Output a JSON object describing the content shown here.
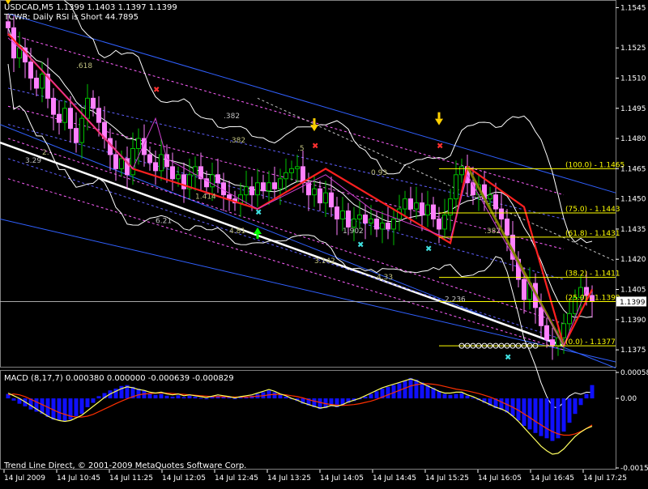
{
  "window": {
    "symbol_line": "USDCAD,M5  1.1399 1.1403 1.1397 1.1399",
    "indicator_line": "TCWR: Daily RSI is Short 44.7895",
    "footer": "Trend Line Direct, © 2001-2009 MetaQuotes Software Corp."
  },
  "colors": {
    "background": "#000000",
    "bull_candle": "#00c000",
    "bear_candle": "#ff80ff",
    "zigzag": "#ff2020",
    "fib": "#ffff00",
    "bands": "#ffffff",
    "trend_blue": "#3060ff",
    "macd_hist": "#1010ff",
    "macd_signal": "#ff3000",
    "macd_main": "#ffff60"
  },
  "chart_data": [
    {
      "type": "candlestick",
      "panel": "price",
      "ylim": [
        1.1367,
        1.1548
      ],
      "y_ticks": [
        "1.1545",
        "1.1525",
        "1.1510",
        "1.1495",
        "1.1480",
        "1.1465",
        "1.1450",
        "1.1435",
        "1.1420",
        "1.1405",
        "1.1390",
        "1.1375"
      ],
      "current_price": "1.1399",
      "x_ticks": [
        "14 Jul 2009",
        "14 Jul 10:45",
        "14 Jul 11:25",
        "14 Jul 12:05",
        "14 Jul 12:45",
        "14 Jul 13:25",
        "14 Jul 14:05",
        "14 Jul 14:45",
        "14 Jul 15:25",
        "14 Jul 16:05",
        "14 Jul 16:45",
        "14 Jul 17:25"
      ],
      "bar_count": 104,
      "closes": [
        1.1535,
        1.152,
        1.1525,
        1.1518,
        1.151,
        1.1505,
        1.1512,
        1.15,
        1.1492,
        1.1488,
        1.1495,
        1.1485,
        1.1478,
        1.149,
        1.15,
        1.1495,
        1.1488,
        1.148,
        1.1472,
        1.1465,
        1.147,
        1.1462,
        1.1475,
        1.148,
        1.1472,
        1.1468,
        1.1464,
        1.1472,
        1.1466,
        1.146,
        1.1462,
        1.1455,
        1.1462,
        1.1466,
        1.146,
        1.1456,
        1.1462,
        1.1458,
        1.1452,
        1.145,
        1.1448,
        1.1452,
        1.1456,
        1.1452,
        1.1458,
        1.1454,
        1.1458,
        1.1455,
        1.146,
        1.1463,
        1.1465,
        1.1466,
        1.1458,
        1.1452,
        1.1455,
        1.1448,
        1.1453,
        1.1446,
        1.144,
        1.1444,
        1.1436,
        1.144,
        1.1442,
        1.1438,
        1.144,
        1.1435,
        1.1438,
        1.1435,
        1.144,
        1.1445,
        1.145,
        1.1445,
        1.1448,
        1.1442,
        1.1447,
        1.144,
        1.1435,
        1.1442,
        1.145,
        1.1462,
        1.1466,
        1.1458,
        1.1452,
        1.1457,
        1.145,
        1.1452,
        1.1445,
        1.144,
        1.1432,
        1.142,
        1.141,
        1.14,
        1.1408,
        1.1396,
        1.1387,
        1.138,
        1.1377,
        1.1381,
        1.1388,
        1.1393,
        1.1401,
        1.1406,
        1.1402,
        1.1399
      ],
      "zigzag": [
        [
          0,
          1.1532
        ],
        [
          22,
          1.1465
        ],
        [
          44,
          1.1445
        ],
        [
          56,
          1.1465
        ],
        [
          78,
          1.1428
        ],
        [
          81,
          1.1466
        ],
        [
          91,
          1.1446
        ],
        [
          98,
          1.1377
        ],
        [
          103,
          1.1405
        ]
      ],
      "fib_levels": [
        {
          "ratio": "100.0",
          "price": 1.1465,
          "label": "(100.0) - 1.1465"
        },
        {
          "ratio": "75.0",
          "price": 1.1443,
          "label": "(75.0) - 1.1443"
        },
        {
          "ratio": "61.8",
          "price": 1.1431,
          "label": "(61.8) - 1.1431"
        },
        {
          "ratio": "38.2",
          "price": 1.1411,
          "label": "(38.2) - 1.1411"
        },
        {
          "ratio": "25.0",
          "price": 1.1399,
          "label": "(25.0) - 1.1399"
        },
        {
          "ratio": "0.0",
          "price": 1.1377,
          "label": "(0.0) - 1.1377"
        }
      ],
      "ratio_labels": [
        ".618",
        ".382",
        ".382",
        ".5",
        "3.29",
        "2.",
        "1.414",
        "6.21",
        "4.81",
        "3.142",
        "1.902",
        "0.93",
        "4.33",
        "2.236",
        ".382"
      ]
    },
    {
      "type": "bar",
      "panel": "macd",
      "title": "MACD (8,17,7) 0.000380 0.000000 -0.000639 -0.000829",
      "ylim": [
        -0.00157,
        0.000586
      ],
      "y_ticks": [
        "0.000586",
        "0.00",
        "-0.00157"
      ],
      "histogram": [
        0.0001,
        -5e-05,
        -0.00012,
        -0.00018,
        -0.00025,
        -0.0003,
        -0.00035,
        -0.00042,
        -0.00048,
        -0.0005,
        -0.00052,
        -0.00048,
        -0.0004,
        -0.00035,
        -0.0002,
        -0.0001,
        5e-05,
        0.00012,
        0.00018,
        0.00022,
        0.00028,
        0.0003,
        0.00026,
        0.00022,
        0.00018,
        0.00012,
        8e-05,
        0.0001,
        6e-05,
        4e-05,
        7e-05,
        3e-05,
        6e-05,
        4e-05,
        1e-05,
        -2e-05,
        3e-05,
        6e-05,
        4e-05,
        2e-05,
        -1e-05,
        2e-05,
        4e-05,
        6e-05,
        0.0001,
        0.00014,
        0.00018,
        0.00014,
        8e-05,
        4e-05,
        -2e-05,
        -6e-05,
        -0.00012,
        -0.00016,
        -0.0002,
        -0.00024,
        -0.00022,
        -0.00018,
        -0.0002,
        -0.00016,
        -0.0001,
        -6e-05,
        -2e-05,
        4e-05,
        0.0001,
        0.00016,
        0.00022,
        0.00026,
        0.0003,
        0.00034,
        0.0004,
        0.00046,
        0.00042,
        0.00036,
        0.0003,
        0.00024,
        0.00016,
        0.0001,
        8e-05,
        0.0001,
        0.00012,
        6e-05,
        2e-05,
        -4e-05,
        -0.0001,
        -0.00016,
        -0.00022,
        -0.00026,
        -0.00032,
        -0.0004,
        -0.0005,
        -0.00062,
        -0.0007,
        -0.00078,
        -0.00085,
        -0.0009,
        -0.00096,
        -0.0009,
        -0.00075,
        -0.00055,
        -0.00035,
        -0.00015,
        0.0001,
        0.0003
      ],
      "signal": [
        8e-05,
        0.0001,
        8e-05,
        4e-05,
        -2e-05,
        -8e-05,
        -0.00014,
        -0.0002,
        -0.00026,
        -0.00032,
        -0.00036,
        -0.0004,
        -0.00042,
        -0.00042,
        -0.0004,
        -0.00036,
        -0.0003,
        -0.00024,
        -0.00018,
        -0.00012,
        -6e-05,
        -1e-05,
        4e-05,
        8e-05,
        0.0001,
        0.00011,
        0.00012,
        0.00012,
        0.00012,
        0.00011,
        0.0001,
        9e-05,
        8e-05,
        7e-05,
        6e-05,
        5e-05,
        4e-05,
        4e-05,
        4e-05,
        3e-05,
        3e-05,
        3e-05,
        3e-05,
        4e-05,
        5e-05,
        6e-05,
        8e-05,
        9e-05,
        9e-05,
        8e-05,
        6e-05,
        4e-05,
        1e-05,
        -3e-05,
        -6e-05,
        -9e-05,
        -0.00012,
        -0.00014,
        -0.00015,
        -0.00016,
        -0.00015,
        -0.00014,
        -0.00012,
        -9e-05,
        -6e-05,
        -2e-05,
        3e-05,
        8e-05,
        0.00013,
        0.00018,
        0.00023,
        0.00028,
        0.00031,
        0.00033,
        0.00033,
        0.00032,
        0.0003,
        0.00027,
        0.00024,
        0.00021,
        0.00019,
        0.00017,
        0.00014,
        0.00011,
        7e-05,
        3e-05,
        -2e-05,
        -8e-05,
        -0.00014,
        -0.0002,
        -0.00027,
        -0.00035,
        -0.00043,
        -0.00052,
        -0.0006,
        -0.00068,
        -0.00075,
        -0.0008,
        -0.00083,
        -0.00083,
        -0.0008,
        -0.00075,
        -0.00068,
        -0.0006
      ],
      "main": [
        0.00012,
        6e-05,
        0.0,
        -8e-05,
        -0.00016,
        -0.00024,
        -0.00032,
        -0.0004,
        -0.00046,
        -0.0005,
        -0.00052,
        -0.0005,
        -0.00044,
        -0.00038,
        -0.00028,
        -0.00018,
        -8e-05,
        2e-05,
        0.0001,
        0.00016,
        0.00022,
        0.00026,
        0.00024,
        0.0002,
        0.00018,
        0.00014,
        0.00012,
        0.00014,
        0.0001,
        8e-05,
        0.0001,
        6e-05,
        8e-05,
        6e-05,
        4e-05,
        2e-05,
        5e-05,
        8e-05,
        6e-05,
        4e-05,
        1e-05,
        4e-05,
        6e-05,
        8e-05,
        0.00012,
        0.00016,
        0.0002,
        0.00016,
        0.0001,
        6e-05,
        0.0,
        -4e-05,
        -0.0001,
        -0.00014,
        -0.00018,
        -0.00022,
        -0.0002,
        -0.00016,
        -0.00018,
        -0.00014,
        -8e-05,
        -4e-05,
        0.0,
        6e-05,
        0.00012,
        0.00018,
        0.00024,
        0.00028,
        0.00032,
        0.00036,
        0.0004,
        0.00044,
        0.0004,
        0.00034,
        0.00028,
        0.00022,
        0.00016,
        0.00012,
        0.00012,
        0.00014,
        0.00014,
        8e-05,
        4e-05,
        -2e-05,
        -8e-05,
        -0.00014,
        -0.0002,
        -0.00024,
        -0.0003,
        -0.0004,
        -0.00052,
        -0.00066,
        -0.0008,
        -0.00094,
        -0.00108,
        -0.00118,
        -0.00126,
        -0.00124,
        -0.00114,
        -0.001,
        -0.00086,
        -0.00076,
        -0.00068,
        -0.00063
      ]
    }
  ]
}
